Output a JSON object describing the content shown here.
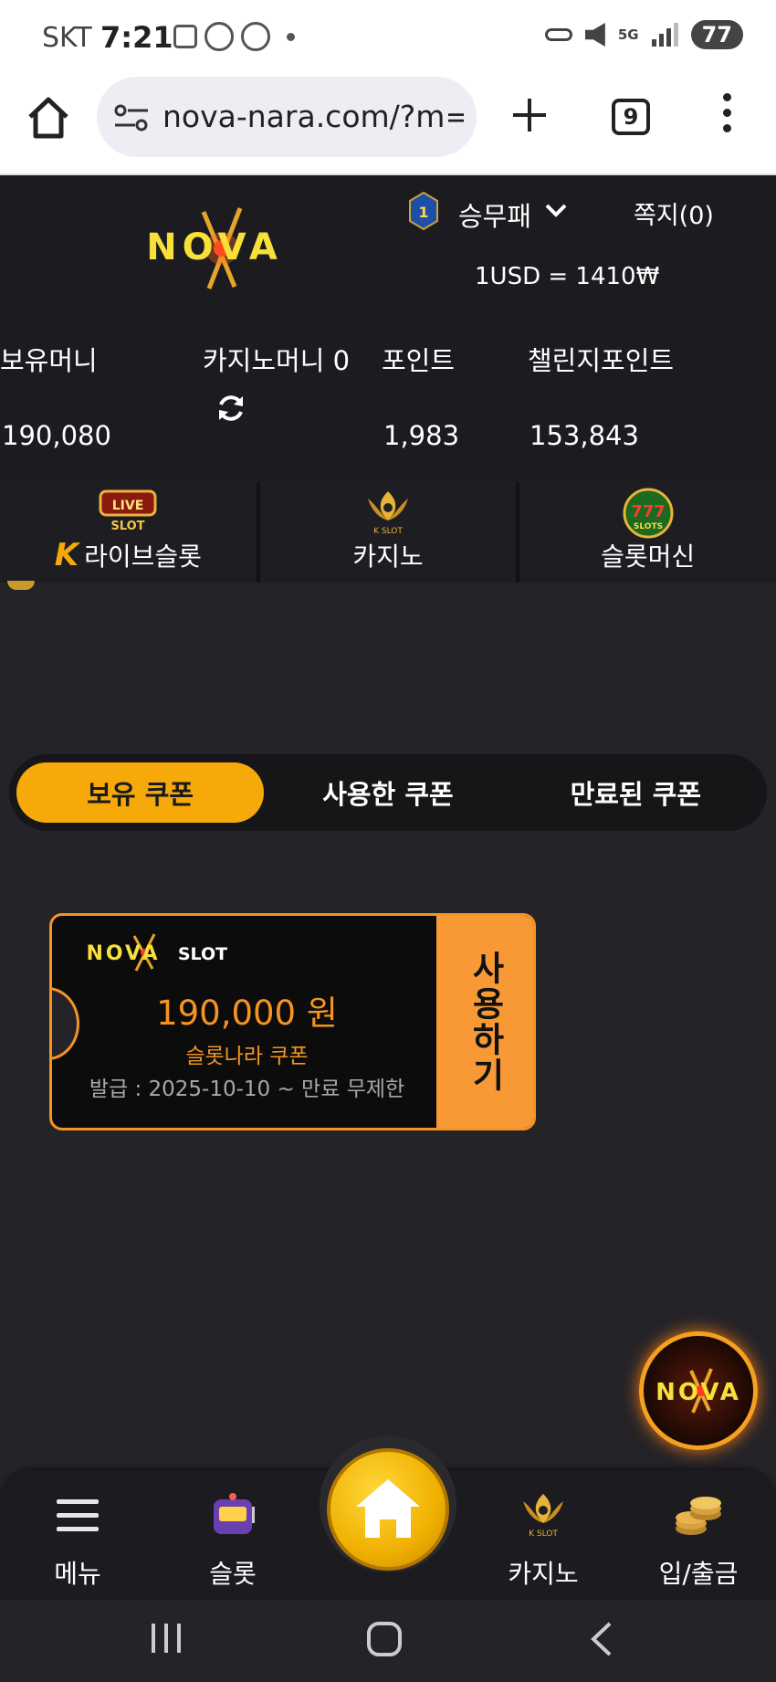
{
  "status_bar": {
    "carrier": "SKT",
    "time": "7:21",
    "network": "5G",
    "battery": "77"
  },
  "browser": {
    "url": "nova-nara.com/?m=",
    "tab_count": "9"
  },
  "header": {
    "logo_text": "NOVA",
    "level": "1",
    "username": "승무패",
    "messages": "쪽지(0)",
    "exchange_rate": "1USD = 1410₩"
  },
  "stats": {
    "balance_label": "보유머니",
    "balance_value": "190,080",
    "casino_money_label": "카지노머니 0",
    "points_label": "포인트",
    "points_value": "1,983",
    "challenge_points_label": "챌린지포인트",
    "challenge_points_value": "153,843"
  },
  "categories": [
    {
      "label": "라이브슬롯",
      "icon_text": "LIVE",
      "icon_sub": "SLOT",
      "prefix": "K"
    },
    {
      "label": "카지노",
      "icon_sub": "K SLOT"
    },
    {
      "label": "슬롯머신",
      "icon_text": "777",
      "icon_sub": "SLOTS"
    }
  ],
  "coupon_tabs": [
    {
      "label": "보유 쿠폰",
      "active": true
    },
    {
      "label": "사용한 쿠폰",
      "active": false
    },
    {
      "label": "만료된 쿠폰",
      "active": false
    }
  ],
  "coupon": {
    "brand": "NOVA",
    "brand_sub": "SLOT",
    "amount": "190,000 원",
    "name": "슬롯나라 쿠폰",
    "issued": "발급 : 2025-10-10 ~ 만료 무제한",
    "use_label": "사용하기"
  },
  "float_button": {
    "text": "NOVA"
  },
  "bottom_nav": {
    "menu": "메뉴",
    "slot": "슬롯",
    "casino": "카지노",
    "casino_icon_sub": "K SLOT",
    "deposit": "입/출금"
  },
  "colors": {
    "accent": "#f7a90a",
    "coupon_orange": "#f99935",
    "background": "#242328"
  }
}
